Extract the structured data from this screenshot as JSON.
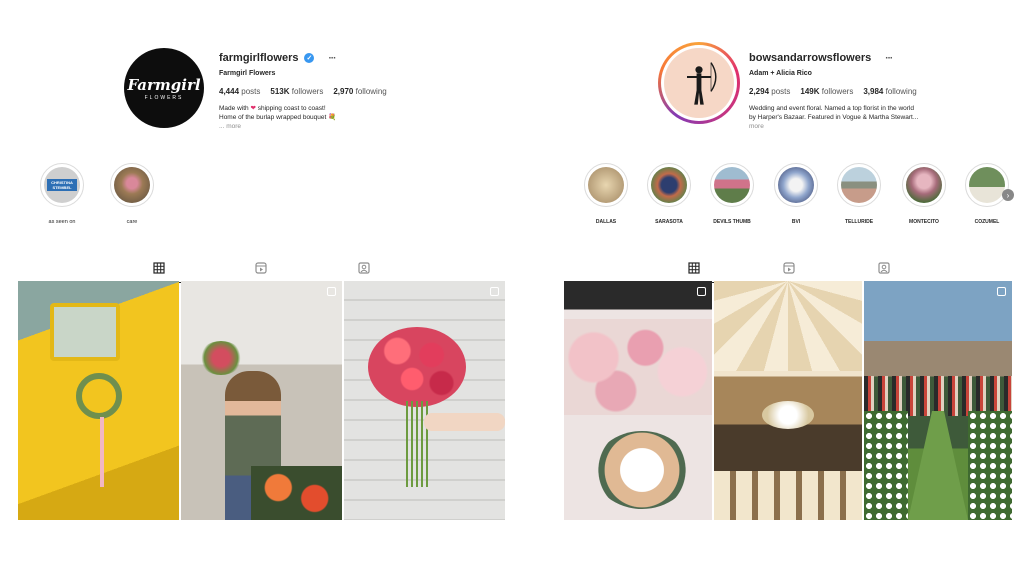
{
  "left": {
    "username": "farmgirlflowers",
    "fullname": "Farmgirl Flowers",
    "avatar_text": "Farmgirl",
    "avatar_subtext": "FLOWERS",
    "stats": {
      "posts": "4,444",
      "posts_label": "posts",
      "followers": "513K",
      "followers_label": "followers",
      "following": "2,970",
      "following_label": "following"
    },
    "bio": {
      "line1a": "Made with",
      "line1b": "shipping coast to coast!",
      "line2": "Home of the burlap wrapped bouquet 💐",
      "more": "... more"
    },
    "highlights": [
      {
        "label": "as seen on",
        "badge": "CHRISTINA STEMBEL",
        "color": "#2d6fb5"
      },
      {
        "label": "care",
        "color": "#b28a6a"
      }
    ],
    "posts": [
      {
        "desc": "yellow truck wreath",
        "color": "#f2c51f"
      },
      {
        "desc": "woman in flower shop",
        "color": "#8a7b6b"
      },
      {
        "desc": "pink dahlia bouquet",
        "color": "#e1e1df"
      }
    ]
  },
  "right": {
    "username": "bowsandarrowsflowers",
    "fullname": "Adam + Alicia Rico",
    "stats": {
      "posts": "2,294",
      "posts_label": "posts",
      "followers": "149K",
      "followers_label": "followers",
      "following": "3,984",
      "following_label": "following"
    },
    "bio": {
      "line1": "Wedding and event floral. Named a top florist in the world",
      "line2": "by Harper's Bazaar. Featured in Vogue & Martha Stewart...",
      "more": "more"
    },
    "highlights": [
      {
        "label": "DALLAS",
        "color": "#c7a77f"
      },
      {
        "label": "SARASOTA",
        "color": "#6a7f4a"
      },
      {
        "label": "DEVILS THUMB",
        "color": "#b46a75"
      },
      {
        "label": "BVI",
        "color": "#7088b8"
      },
      {
        "label": "TELLURIDE",
        "color": "#8da0a6"
      },
      {
        "label": "MONTECITO",
        "color": "#a66b7a"
      },
      {
        "label": "COZUMEL",
        "color": "#6f8f5c"
      }
    ],
    "posts": [
      {
        "desc": "pink table setting",
        "color": "#e8d7d6"
      },
      {
        "desc": "tent ceiling reception",
        "color": "#d9c6a0"
      },
      {
        "desc": "outdoor aisle ceremony",
        "color": "#7da3c3"
      }
    ]
  },
  "colors": {
    "accent": "#3897f0",
    "text": "#262626",
    "muted": "#8e8e8e"
  }
}
